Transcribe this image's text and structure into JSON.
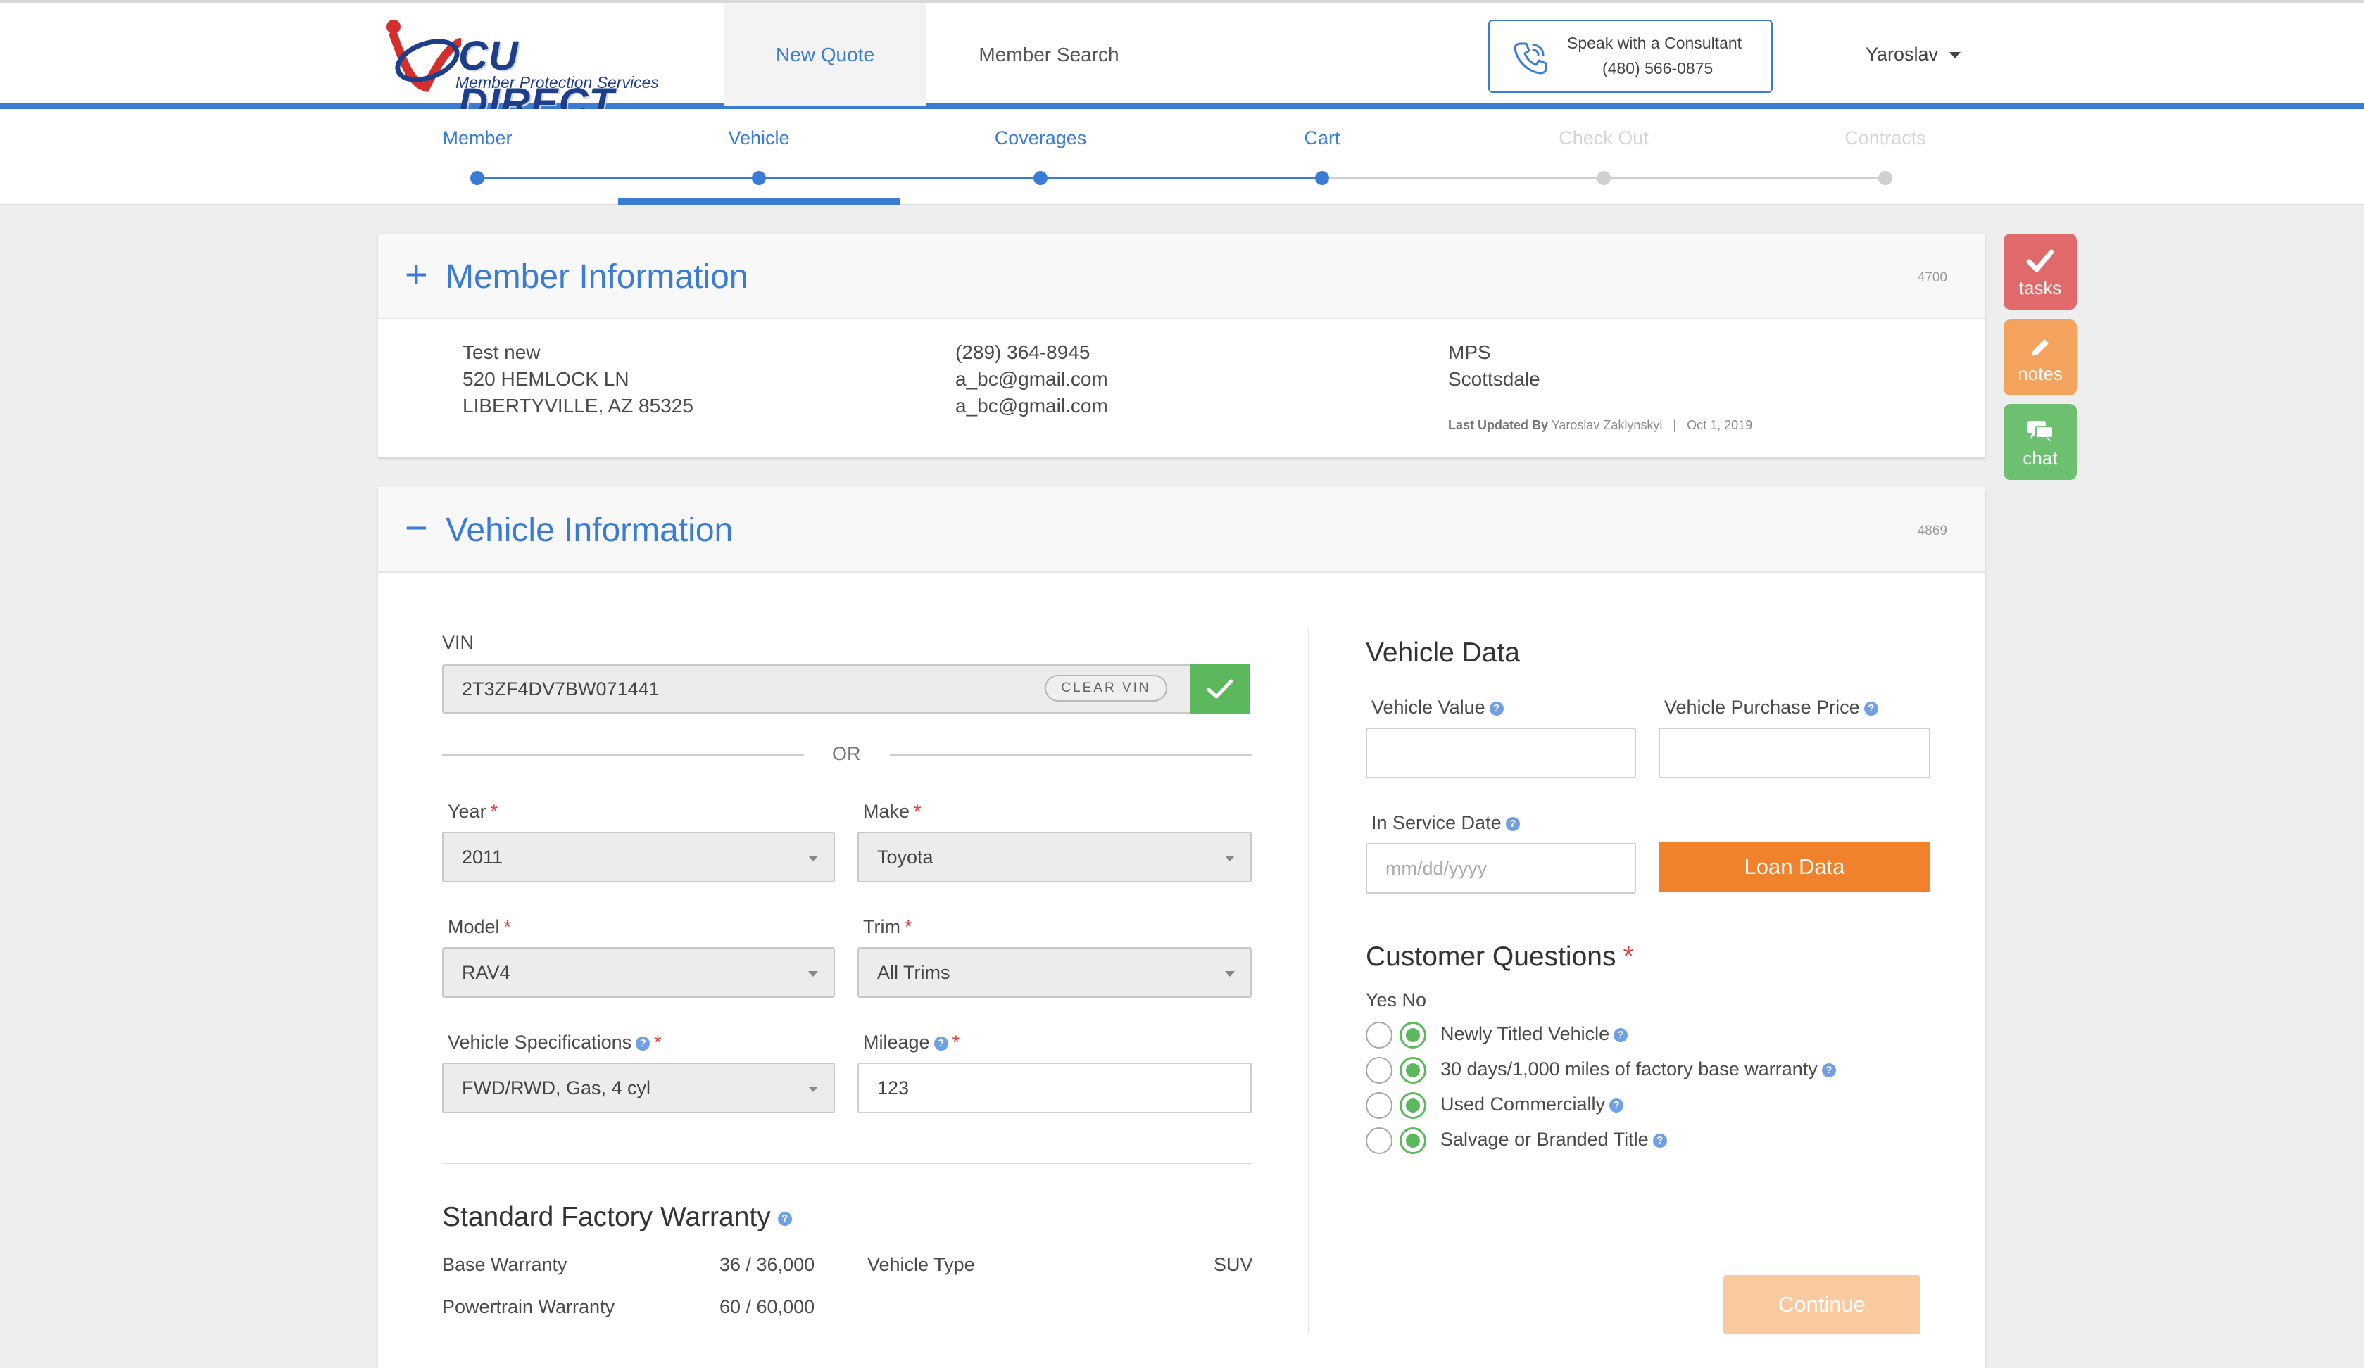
{
  "brand": {
    "logo_text": "CU DIRECT",
    "logo_subtitle": "Member Protection Services"
  },
  "nav": {
    "tabs": [
      {
        "label": "New Quote",
        "active": true
      },
      {
        "label": "Member Search",
        "active": false
      }
    ],
    "consultant": {
      "title": "Speak with a Consultant",
      "phone": "(480) 566-0875"
    },
    "user": "Yaroslav"
  },
  "stepper": {
    "steps": [
      {
        "label": "Member",
        "state": "done"
      },
      {
        "label": "Vehicle",
        "state": "current"
      },
      {
        "label": "Coverages",
        "state": "done"
      },
      {
        "label": "Cart",
        "state": "done"
      },
      {
        "label": "Check Out",
        "state": "disabled"
      },
      {
        "label": "Contracts",
        "state": "disabled"
      }
    ]
  },
  "member_panel": {
    "toggle": "+",
    "title": "Member Information",
    "id": "4700",
    "name": "Test new",
    "address1": "520 HEMLOCK LN",
    "address2": "LIBERTYVILLE, AZ 85325",
    "phone": "(289) 364-8945",
    "email1": "a_bc@gmail.com",
    "email2": "a_bc@gmail.com",
    "org": "MPS",
    "city": "Scottsdale",
    "last_updated_label": "Last Updated By",
    "last_updated_by": "Yaroslav Zaklynskyi",
    "separator": "|",
    "last_updated_date": "Oct 1, 2019"
  },
  "vehicle_panel": {
    "toggle": "−",
    "title": "Vehicle Information",
    "id": "4869",
    "vin": {
      "label": "VIN",
      "value": "2T3ZF4DV7BW071441",
      "clear_label": "CLEAR VIN"
    },
    "or_text": "OR",
    "year": {
      "label": "Year",
      "value": "2011"
    },
    "make": {
      "label": "Make",
      "value": "Toyota"
    },
    "model": {
      "label": "Model",
      "value": "RAV4"
    },
    "trim": {
      "label": "Trim",
      "value": "All Trims"
    },
    "specs": {
      "label": "Vehicle Specifications",
      "value": "FWD/RWD, Gas, 4 cyl"
    },
    "mileage": {
      "label": "Mileage",
      "value": "123"
    },
    "required_mark": "*",
    "help_mark": "?",
    "warranty": {
      "title": "Standard Factory Warranty",
      "rows": [
        {
          "label": "Base Warranty",
          "value": "36 / 36,000"
        },
        {
          "label": "Powertrain Warranty",
          "value": "60 / 60,000"
        }
      ],
      "vehicle_type_label": "Vehicle Type",
      "vehicle_type_value": "SUV"
    }
  },
  "vehicle_data": {
    "title": "Vehicle Data",
    "vehicle_value_label": "Vehicle Value",
    "vehicle_value": "",
    "purchase_price_label": "Vehicle Purchase Price",
    "purchase_price": "",
    "in_service_label": "In Service Date",
    "in_service_placeholder": "mm/dd/yyyy",
    "loan_button": "Loan Data"
  },
  "customer_questions": {
    "title": "Customer Questions",
    "yes_no_header": "Yes No",
    "questions": [
      {
        "text": "Newly Titled Vehicle",
        "answer": "No"
      },
      {
        "text": "30 days/1,000 miles of factory base warranty",
        "answer": "No"
      },
      {
        "text": "Used Commercially",
        "answer": "No"
      },
      {
        "text": "Salvage or Branded Title",
        "answer": "No"
      }
    ]
  },
  "continue_button": "Continue",
  "side_actions": [
    {
      "label": "tasks",
      "color": "#e06a6a"
    },
    {
      "label": "notes",
      "color": "#f4a35e"
    },
    {
      "label": "chat",
      "color": "#6cc070"
    }
  ],
  "colors": {
    "accent": "#3a7bd5",
    "success": "#5cb85c",
    "orange": "#f0822d",
    "required": "#e23b3b"
  }
}
